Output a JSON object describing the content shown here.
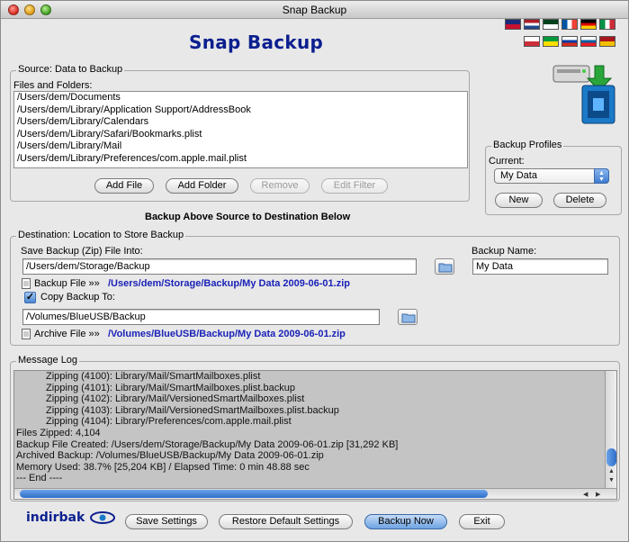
{
  "window": {
    "title": "Snap Backup"
  },
  "app": {
    "title": "Snap Backup",
    "brand": "indirbak"
  },
  "flags": [
    {
      "name": "flag-nz-icon",
      "colors": [
        "#1b2a7a",
        "#c8102e"
      ]
    },
    {
      "name": "flag-nl-icon",
      "colors": [
        "#ae1c28",
        "#ffffff",
        "#21468b"
      ]
    },
    {
      "name": "flag-pk-icon",
      "colors": [
        "#01411c",
        "#ffffff"
      ]
    },
    {
      "name": "flag-fr-icon",
      "colors": [
        "#0055a4",
        "#ffffff",
        "#ef4135"
      ]
    },
    {
      "name": "flag-de-icon",
      "colors": [
        "#000000",
        "#dd0000",
        "#ffce00"
      ]
    },
    {
      "name": "flag-it-icon",
      "colors": [
        "#009246",
        "#ffffff",
        "#ce2b37"
      ]
    },
    {
      "name": "flag-kr-icon",
      "colors": [
        "#ffffff",
        "#cd2e3a"
      ]
    },
    {
      "name": "flag-br-icon",
      "colors": [
        "#009c3b",
        "#ffdf00"
      ]
    },
    {
      "name": "flag-ru-icon",
      "colors": [
        "#ffffff",
        "#0039a6",
        "#d52b1e"
      ]
    },
    {
      "name": "flag-si-icon",
      "colors": [
        "#ffffff",
        "#005da4",
        "#ed1c24"
      ]
    },
    {
      "name": "flag-es-icon",
      "colors": [
        "#aa151b",
        "#f1bf00"
      ]
    }
  ],
  "source": {
    "group_label": "Source: Data to Backup",
    "list_label": "Files and Folders:",
    "items": [
      "/Users/dem/Documents",
      "/Users/dem/Library/Application Support/AddressBook",
      "/Users/dem/Library/Calendars",
      "/Users/dem/Library/Safari/Bookmarks.plist",
      "/Users/dem/Library/Mail",
      "/Users/dem/Library/Preferences/com.apple.mail.plist"
    ],
    "add_file": "Add File",
    "add_folder": "Add Folder",
    "remove": "Remove",
    "edit_filter": "Edit Filter"
  },
  "profiles": {
    "group_label": "Backup Profiles",
    "current_label": "Current:",
    "current_value": "My Data",
    "new": "New",
    "delete": "Delete"
  },
  "divider_text": "Backup Above Source to Destination Below",
  "destination": {
    "group_label": "Destination: Location to Store Backup",
    "save_into_label": "Save Backup (Zip) File Into:",
    "save_into_value": "/Users/dem/Storage/Backup",
    "backup_name_label": "Backup Name:",
    "backup_name_value": "My Data",
    "backup_file_label": "Backup File »»",
    "backup_file_path": "/Users/dem/Storage/Backup/My Data 2009-06-01.zip",
    "copy_label": "Copy Backup To:",
    "copy_checked": true,
    "copy_value": "/Volumes/BlueUSB/Backup",
    "archive_file_label": "Archive File »»",
    "archive_file_path": "/Volumes/BlueUSB/Backup/My Data 2009-06-01.zip"
  },
  "log": {
    "group_label": "Message Log",
    "lines": [
      {
        "text": "Zipping (4100): Library/Mail/SmartMailboxes.plist",
        "indent": true
      },
      {
        "text": "Zipping (4101): Library/Mail/SmartMailboxes.plist.backup",
        "indent": true
      },
      {
        "text": "Zipping (4102): Library/Mail/VersionedSmartMailboxes.plist",
        "indent": true
      },
      {
        "text": "Zipping (4103): Library/Mail/VersionedSmartMailboxes.plist.backup",
        "indent": true
      },
      {
        "text": "Zipping (4104): Library/Preferences/com.apple.mail.plist",
        "indent": true
      },
      {
        "text": "Files Zipped: 4,104",
        "indent": false
      },
      {
        "text": "Backup File Created: /Users/dem/Storage/Backup/My Data 2009-06-01.zip  [31,292 KB]",
        "indent": false
      },
      {
        "text": "Archived Backup: /Volumes/BlueUSB/Backup/My Data 2009-06-01.zip",
        "indent": false
      },
      {
        "text": "Memory Used: 38.7%  [25,204 KB]  /  Elapsed Time: 0 min 48.88 sec",
        "indent": false
      },
      {
        "text": "--- End ----",
        "indent": false
      }
    ]
  },
  "footer": {
    "save_settings": "Save Settings",
    "restore_defaults": "Restore Default Settings",
    "backup_now": "Backup Now",
    "exit": "Exit"
  },
  "colors": {
    "brand_blue": "#0b1f8f",
    "path_blue": "#1a22b8",
    "accent": "#3e7bd0"
  }
}
